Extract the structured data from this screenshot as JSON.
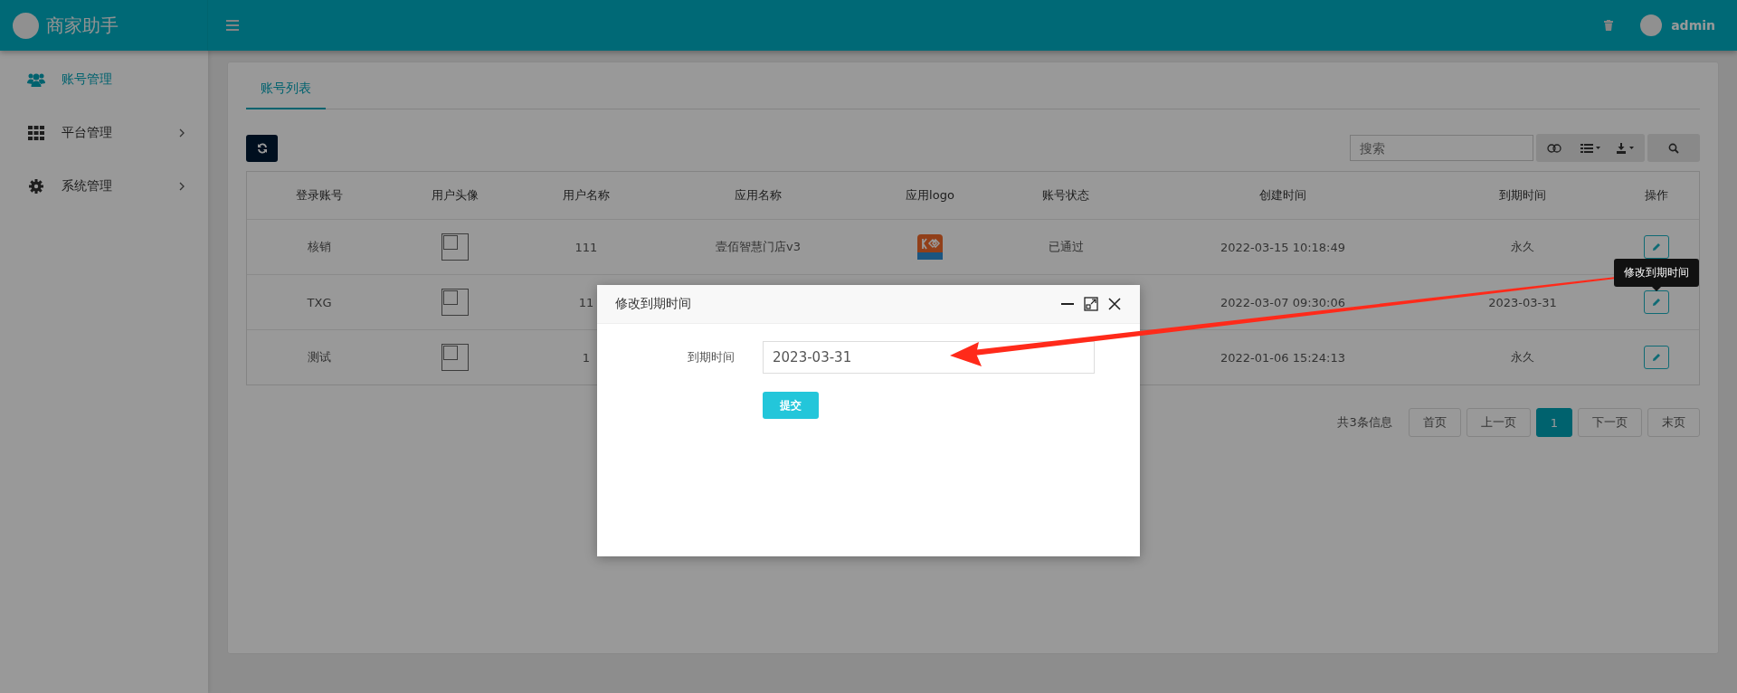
{
  "brand": {
    "name": "商家助手"
  },
  "header": {
    "user": "admin"
  },
  "sidebar": {
    "items": [
      {
        "label": "账号管理",
        "kind": "users",
        "selected": true,
        "has_children": false
      },
      {
        "label": "平台管理",
        "kind": "grid",
        "selected": false,
        "has_children": true
      },
      {
        "label": "系统管理",
        "kind": "gear",
        "selected": false,
        "has_children": true
      }
    ]
  },
  "tabs": [
    {
      "label": "账号列表",
      "selected": true
    }
  ],
  "search": {
    "placeholder": "搜索"
  },
  "table": {
    "columns": [
      "登录账号",
      "用户头像",
      "用户名称",
      "应用名称",
      "应用logo",
      "账号状态",
      "创建时间",
      "到期时间",
      "操作"
    ],
    "rows": [
      {
        "login": "核销",
        "username": "111",
        "app_name": "壹佰智慧门店v3",
        "has_logo": true,
        "status": "已通过",
        "created": "2022-03-15 10:18:49",
        "expires": "永久"
      },
      {
        "login": "TXG",
        "username": "11",
        "created": "2022-03-07 09:30:06",
        "expires": "2023-03-31",
        "tooltip": "修改到期时间"
      },
      {
        "login": "测试",
        "username": "1",
        "created": "2022-01-06 15:24:13",
        "expires": "永久"
      }
    ]
  },
  "pagination": {
    "summary": "共3条信息",
    "buttons": [
      {
        "label": "首页",
        "selected": false
      },
      {
        "label": "上一页",
        "selected": false
      },
      {
        "label": "1",
        "selected": true
      },
      {
        "label": "下一页",
        "selected": false
      },
      {
        "label": "末页",
        "selected": false
      }
    ]
  },
  "modal": {
    "title": "修改到期时间",
    "field_label": "到期时间",
    "value": "2023-03-31",
    "submit": "提交"
  }
}
